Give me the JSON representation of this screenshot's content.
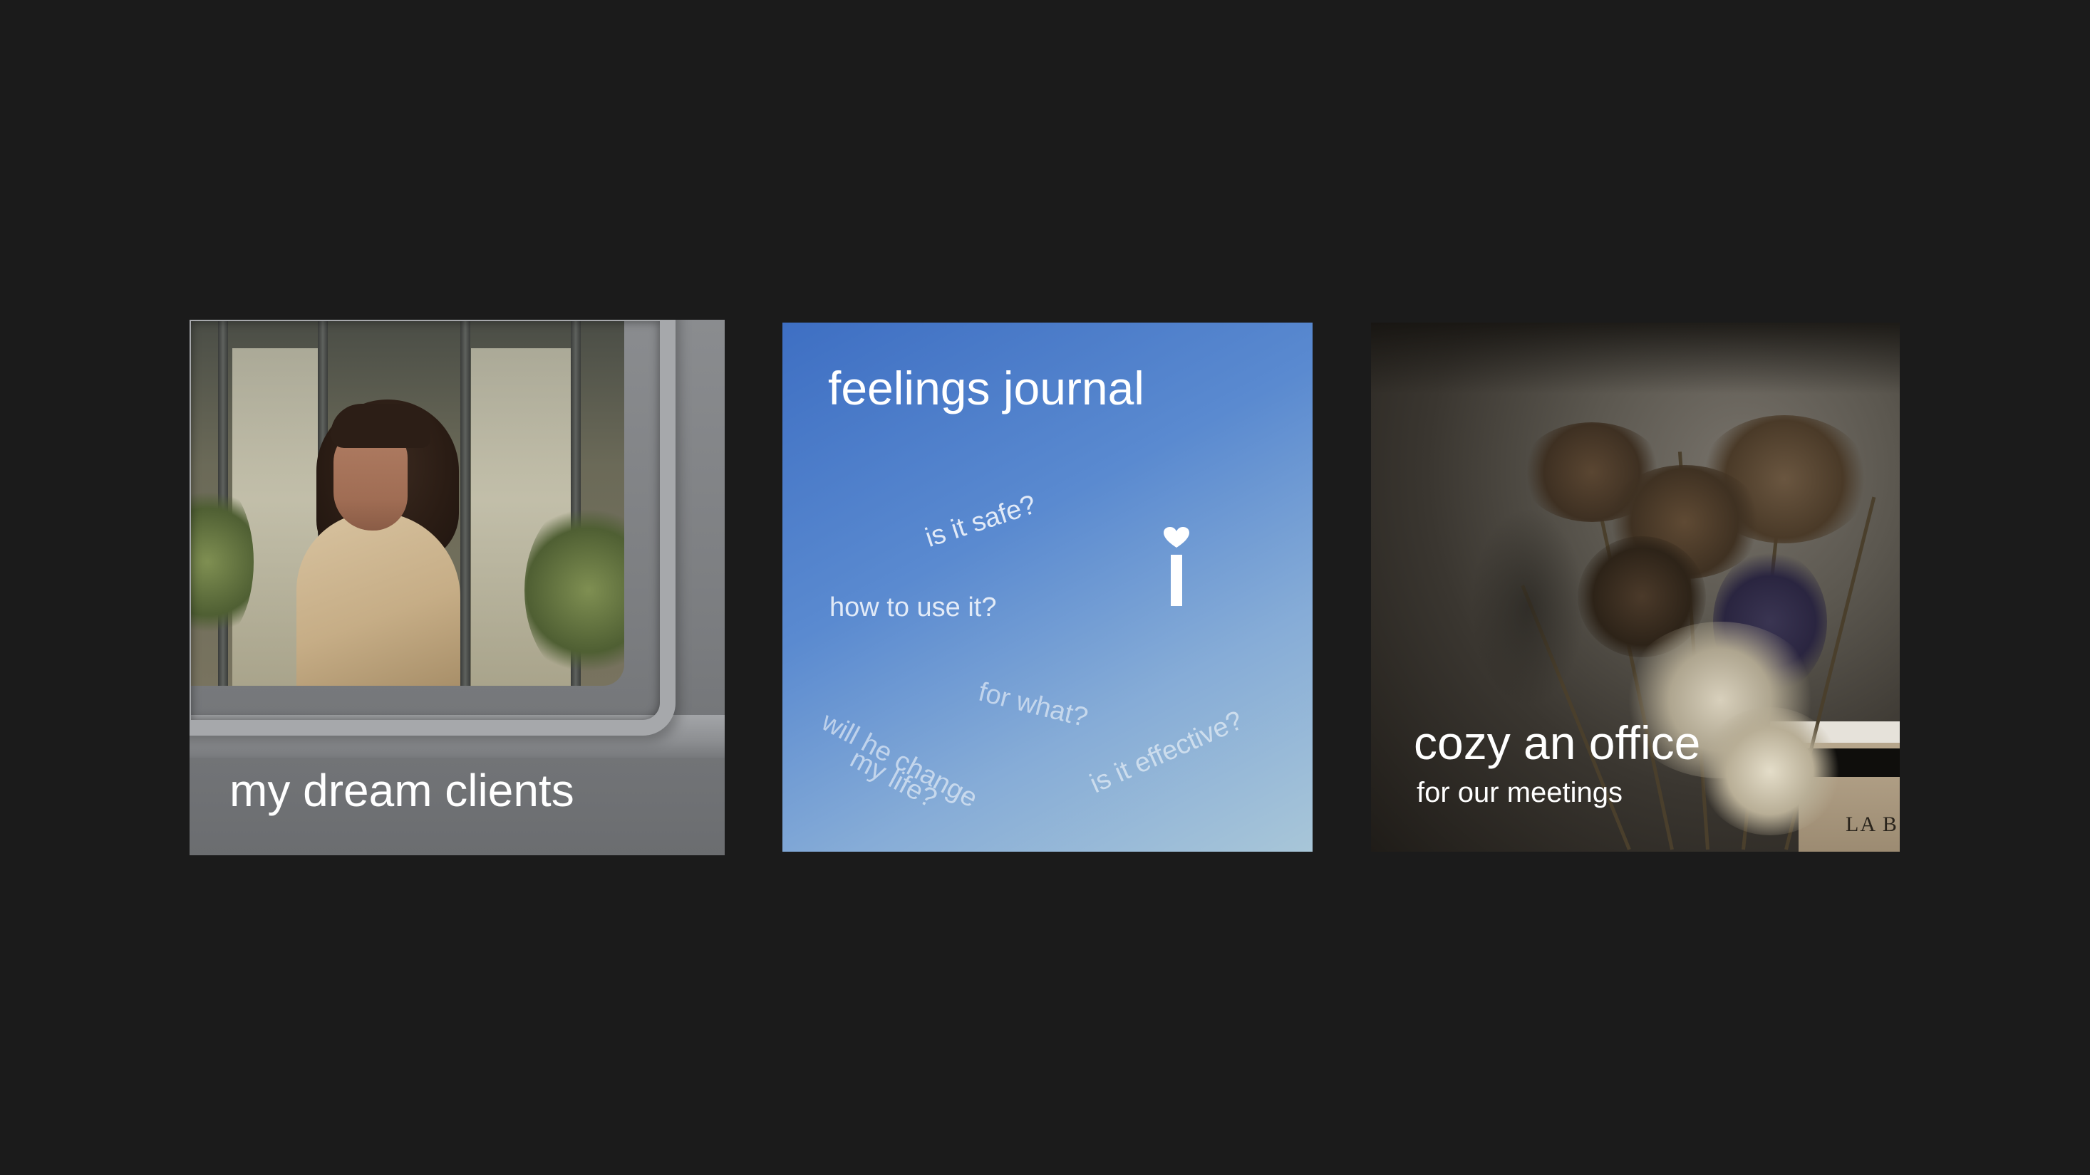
{
  "cards": [
    {
      "title": "my dream clients"
    },
    {
      "title": "feelings journal",
      "questions": [
        "is it safe?",
        "how to use it?",
        "for what?",
        "will he change",
        "my life?",
        "is it effective?"
      ],
      "logo_icon": "heart-i-logo-icon"
    },
    {
      "title": "cozy an office",
      "subtitle": "for our meetings",
      "book_text": "LA B"
    }
  ],
  "colors": {
    "background": "#1b1b1b",
    "journal_gradient_start": "#3e6fc3",
    "journal_gradient_end": "#a8c6d8",
    "text": "#ffffff"
  }
}
